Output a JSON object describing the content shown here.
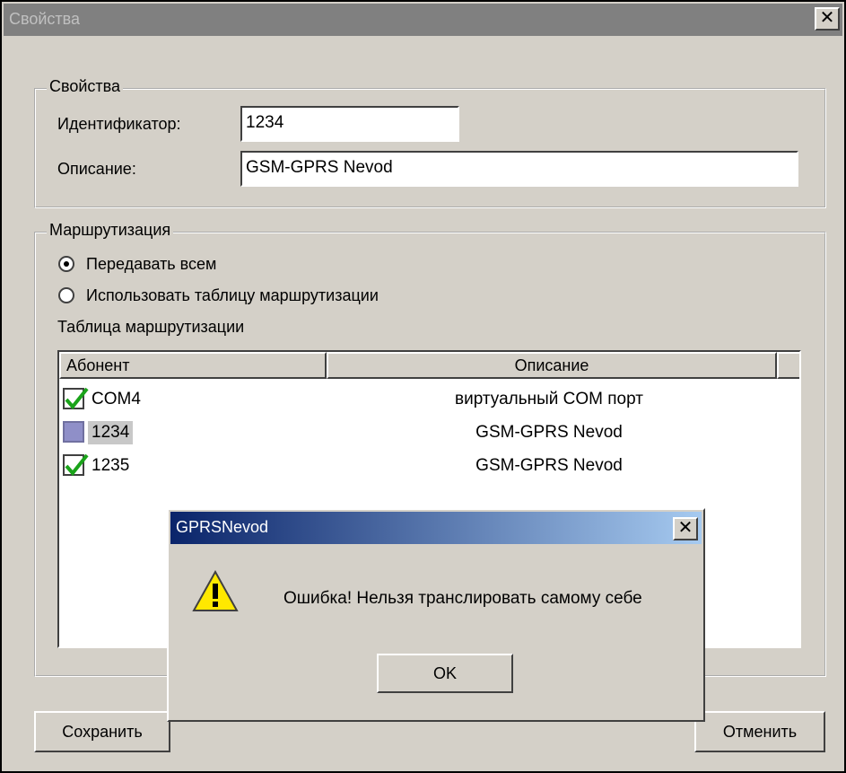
{
  "window": {
    "title": "Свойства"
  },
  "properties_group": {
    "legend": "Свойства",
    "id_label": "Идентификатор:",
    "id_value": "1234",
    "desc_label": "Описание:",
    "desc_value": "GSM-GPRS Nevod"
  },
  "routing_group": {
    "legend": "Маршрутизация",
    "radio_send_all": "Передавать всем",
    "radio_use_table": "Использовать таблицу маршрутизации",
    "selected_radio": "send_all",
    "table_label": "Таблица маршрутизации",
    "columns": [
      "Абонент",
      "Описание"
    ],
    "rows": [
      {
        "subscriber": "COM4",
        "description": "виртуальный COM порт",
        "checked": true
      },
      {
        "subscriber": "1234",
        "description": "GSM-GPRS Nevod",
        "checked": false,
        "selected": true
      },
      {
        "subscriber": "1235",
        "description": "GSM-GPRS Nevod",
        "checked": true
      }
    ]
  },
  "buttons": {
    "save": "Сохранить",
    "cancel": "Отменить"
  },
  "message_box": {
    "title": "GPRSNevod",
    "text": "Ошибка! Нельзя транслировать самому себе",
    "ok": "OK",
    "icon": "warning-icon"
  }
}
